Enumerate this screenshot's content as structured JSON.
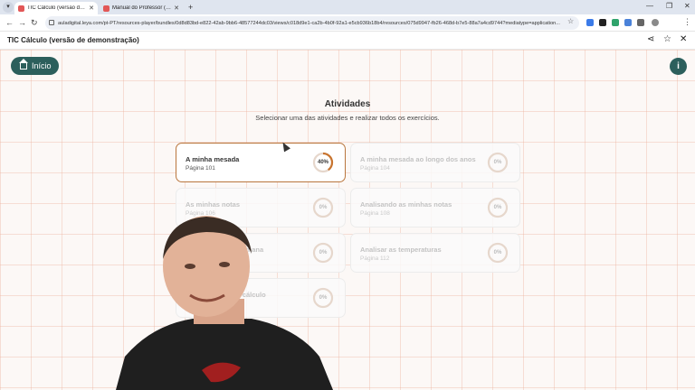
{
  "browser": {
    "tabs": [
      {
        "title": "TIC Cálculo (versão de demonstração)",
        "active": true
      },
      {
        "title": "Manual do Professor (PDF) - Ed",
        "active": false
      }
    ],
    "url": "auladigital.leya.com/pt-PT/resources-player/bundles/0d8d83bd-e822-42ab-9bb6-48577244dc03/views/c018d9e1-ca2b-4b0f-92a1-e5cb936b18b4/resources/075d9947-fb26-468d-b7e5-88a7a4cd9744?mediatype=application..."
  },
  "app": {
    "title": "TIC Cálculo (versão de demonstração)"
  },
  "home_button": {
    "label": "Início"
  },
  "info_button": {
    "label": "i"
  },
  "page": {
    "heading": "Atividades",
    "subheading": "Selecionar uma das atividades e realizar todos os exercícios."
  },
  "activities": [
    {
      "title": "A minha mesada",
      "page": "Página 101",
      "progress_label": "40%",
      "progress": 0.4,
      "active": true
    },
    {
      "title": "A minha mesada ao longo dos anos",
      "page": "Página 104",
      "progress_label": "0%",
      "progress": 0,
      "active": false
    },
    {
      "title": "As minhas notas",
      "page": "Página 106",
      "progress_label": "0%",
      "progress": 0,
      "active": false
    },
    {
      "title": "Analisando as minhas notas",
      "page": "Página 108",
      "progress_label": "0%",
      "progress": 0,
      "active": false
    },
    {
      "title": "a semana",
      "page": "",
      "progress_label": "0%",
      "progress": 0,
      "active": false
    },
    {
      "title": "Analisar as temperaturas",
      "page": "Página 112",
      "progress_label": "0%",
      "progress": 0,
      "active": false
    },
    {
      "title": "de cálculo",
      "page": "",
      "progress_label": "0%",
      "progress": 0,
      "active": false
    }
  ],
  "colors": {
    "accent": "#2c5f5c",
    "progress": "#c8742f",
    "ring_empty": "#e6d7cc"
  }
}
